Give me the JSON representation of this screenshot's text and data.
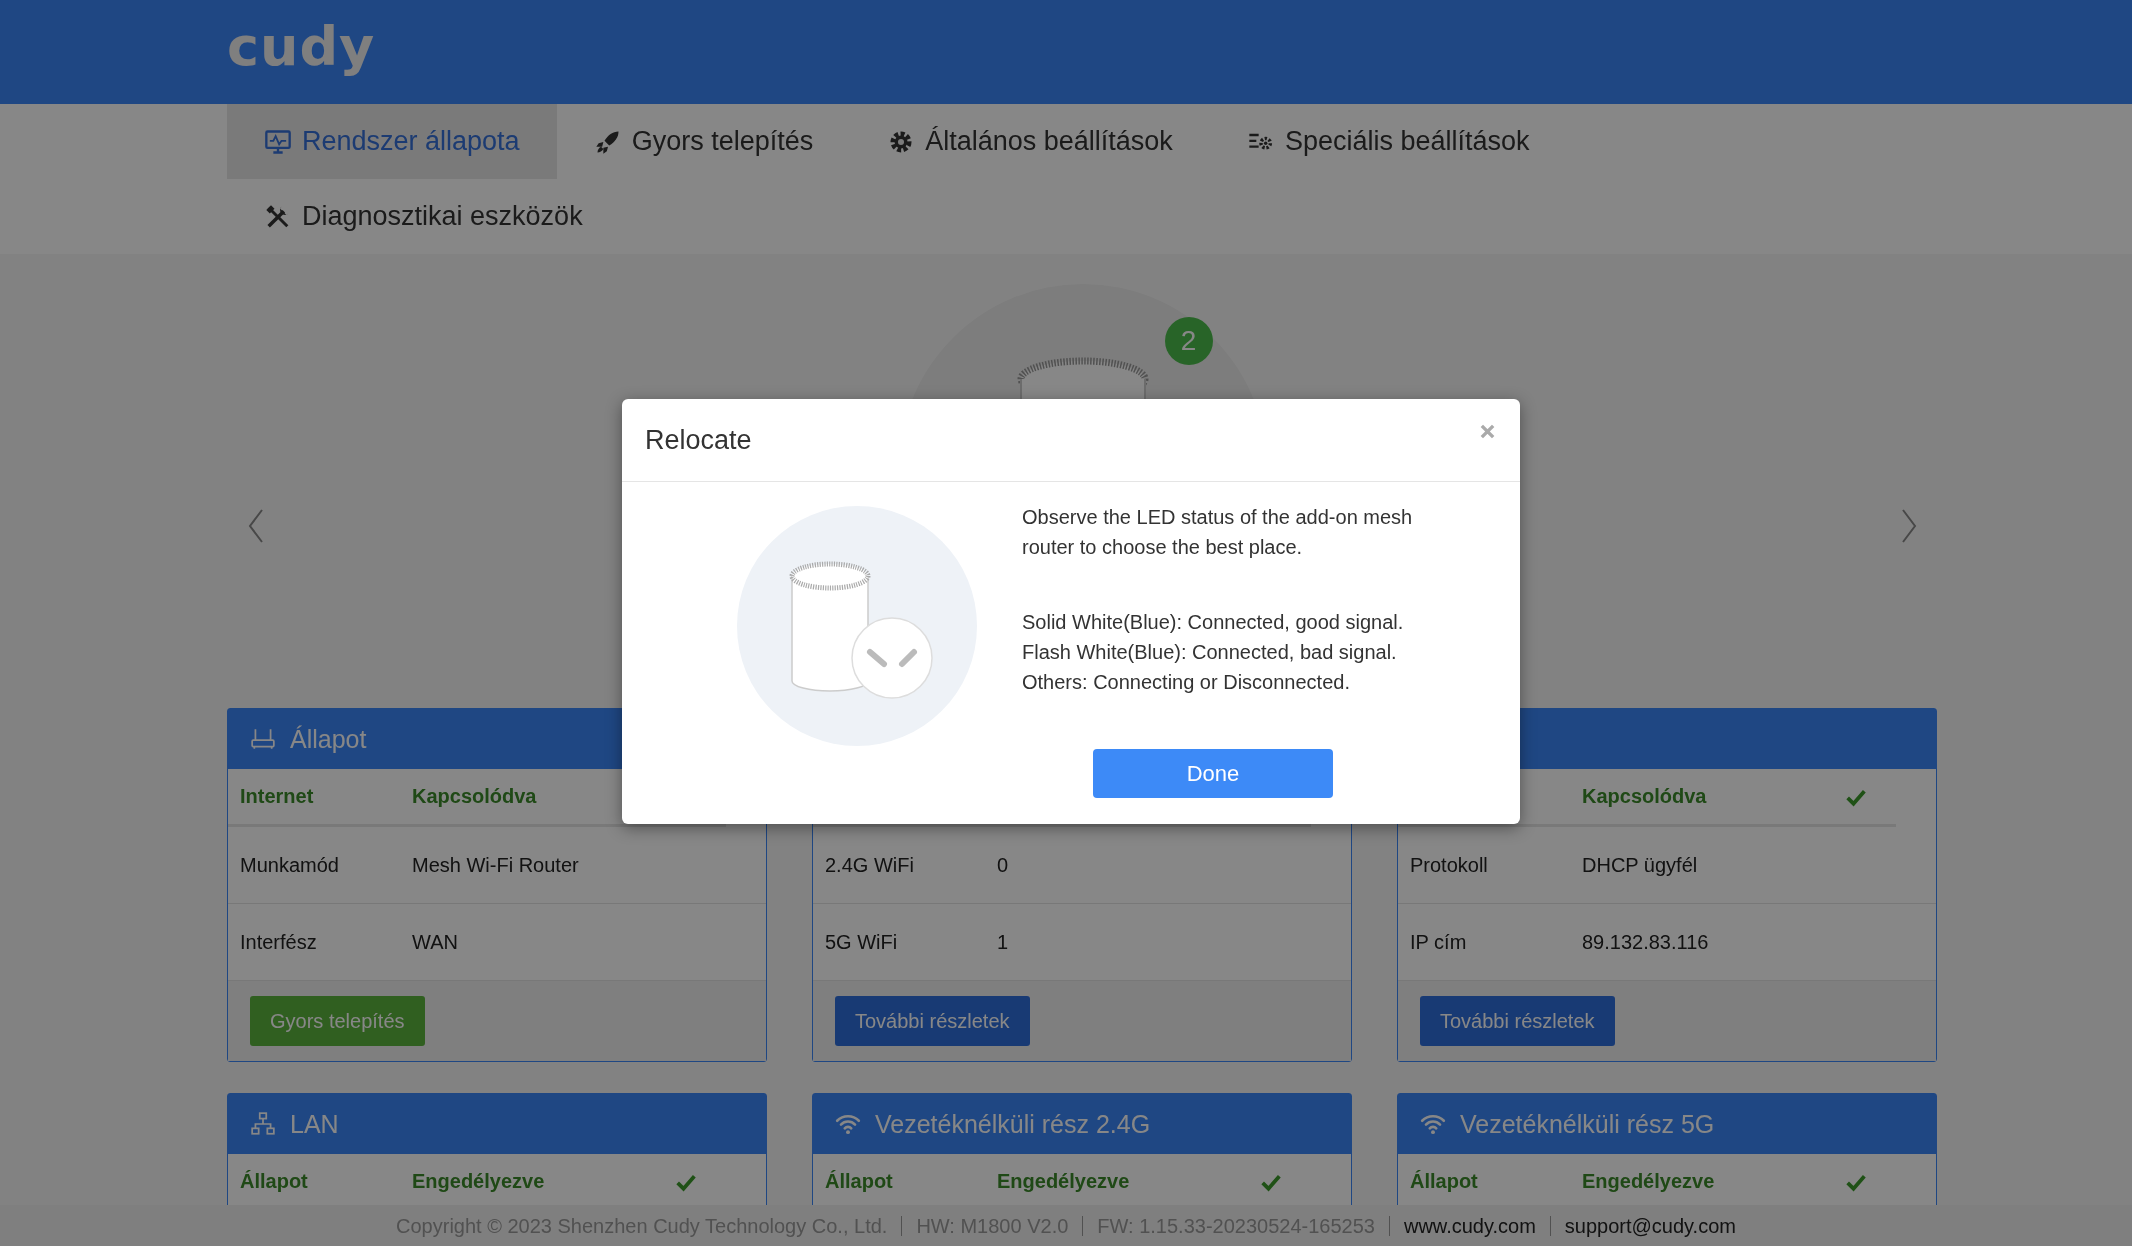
{
  "brand": {
    "logo": "cudy"
  },
  "nav": [
    {
      "label": "Rendszer állapota",
      "selected": true
    },
    {
      "label": "Gyors telepítés",
      "selected": false
    },
    {
      "label": "Általános beállítások",
      "selected": false
    },
    {
      "label": "Speciális beállítások",
      "selected": false
    },
    {
      "label": "Diagnosztikai eszközök",
      "selected": false
    }
  ],
  "carousel": {
    "badge": "2"
  },
  "cards": [
    {
      "kind": "internet",
      "title": "Állapot",
      "rows": [
        {
          "kind": "status",
          "label": "Internet",
          "value": "Kapcsolódva"
        },
        {
          "kind": "plain",
          "label": "Munkamód",
          "value": "Mesh Wi-Fi Router"
        },
        {
          "kind": "plain",
          "label": "Interfész",
          "value": "WAN"
        }
      ],
      "button": {
        "label": "Gyors telepítés",
        "kind": "success"
      }
    },
    {
      "rows": [
        {
          "kind": "status"
        },
        {
          "kind": "plain",
          "label": "2.4G WiFi",
          "value": "0"
        },
        {
          "kind": "plain",
          "label": "5G WiFi",
          "value": "1"
        }
      ],
      "button": {
        "label": "További részletek",
        "kind": "primary"
      }
    },
    {
      "rows": [
        {
          "kind": "status",
          "value": "Kapcsolódva",
          "ok": true
        },
        {
          "kind": "plain",
          "label": "Protokoll",
          "value": "DHCP ügyfél"
        },
        {
          "kind": "plain",
          "label": "IP cím",
          "value": "89.132.83.116"
        }
      ],
      "button": {
        "label": "További részletek",
        "kind": "primary"
      }
    },
    {
      "kind": "lan",
      "title": "LAN",
      "rows": [
        {
          "kind": "status",
          "label": "Állapot",
          "value": "Engedélyezve",
          "ok": true
        }
      ]
    },
    {
      "kind": "wireless",
      "title": "Vezetéknélküli rész 2.4G",
      "rows": [
        {
          "kind": "status",
          "label": "Állapot",
          "value": "Engedélyezve",
          "ok": true
        }
      ]
    },
    {
      "kind": "wireless",
      "title": "Vezetéknélküli rész 5G",
      "rows": [
        {
          "kind": "status",
          "label": "Állapot",
          "value": "Engedélyezve",
          "ok": true
        }
      ]
    }
  ],
  "footer": [
    {
      "kind": "info",
      "text": "Copyright © 2023 Shenzhen Cudy Technology Co., Ltd."
    },
    {
      "kind": "info",
      "text": "HW: M1800 V2.0"
    },
    {
      "kind": "info",
      "text": "FW: 1.15.33-20230524-165253"
    },
    {
      "kind": "link",
      "text": "www.cudy.com"
    },
    {
      "kind": "link",
      "text": "support@cudy.com"
    }
  ],
  "modal": {
    "title": "Relocate",
    "paragraphs": [
      "Observe the LED status of the add-on mesh\nrouter to choose the best place.",
      "Solid White(Blue): Connected, good signal.\nFlash White(Blue): Connected, bad signal.\nOthers: Connecting or Disconnected."
    ],
    "button": "Done"
  }
}
